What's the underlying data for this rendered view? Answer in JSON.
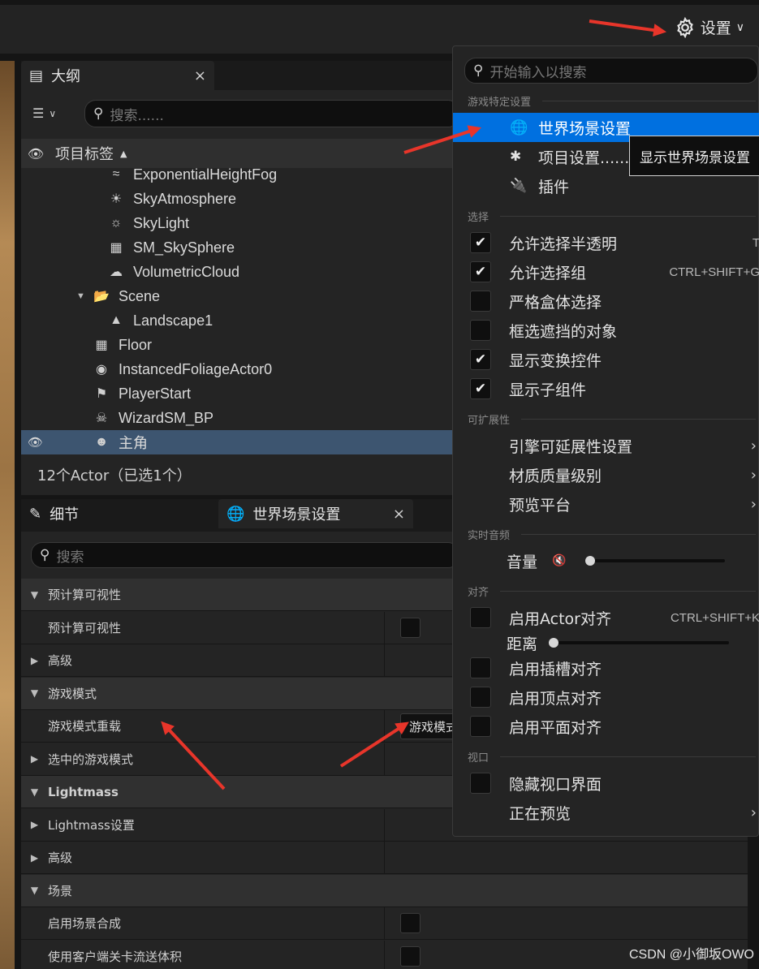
{
  "topbar": {
    "settings_label": "设置"
  },
  "outliner": {
    "tab_label": "大纲",
    "close": "×",
    "search_placeholder": "搜索......",
    "column_header": "项目标签",
    "items": [
      {
        "label": "ExponentialHeightFog",
        "icon": "fog-icon"
      },
      {
        "label": "SkyAtmosphere",
        "icon": "sky-atmosphere-icon"
      },
      {
        "label": "SkyLight",
        "icon": "skylight-icon"
      },
      {
        "label": "SM_SkySphere",
        "icon": "mesh-icon"
      },
      {
        "label": "VolumetricCloud",
        "icon": "cloud-icon"
      },
      {
        "label": "Scene",
        "icon": "folder-icon"
      },
      {
        "label": "Landscape1",
        "icon": "landscape-icon"
      },
      {
        "label": "Floor",
        "icon": "mesh-icon"
      },
      {
        "label": "InstancedFoliageActor0",
        "icon": "foliage-icon"
      },
      {
        "label": "PlayerStart",
        "icon": "player-start-icon"
      },
      {
        "label": "WizardSM_BP",
        "icon": "skeleton-icon"
      },
      {
        "label": "主角",
        "icon": "character-icon"
      }
    ],
    "footer": "12个Actor（已选1个）"
  },
  "details": {
    "tab_details": "细节",
    "tab_world": "世界场景设置",
    "close": "×",
    "search_placeholder": "搜索",
    "rows": [
      {
        "label": "预计算可视性",
        "type": "category"
      },
      {
        "label": "预计算可视性",
        "type": "property"
      },
      {
        "label": "高级",
        "type": "collapsed"
      },
      {
        "label": "游戏模式",
        "type": "category"
      },
      {
        "label": "游戏模式重载",
        "type": "property"
      },
      {
        "label": "选中的游戏模式",
        "type": "collapsed"
      },
      {
        "label": "Lightmass",
        "type": "category"
      },
      {
        "label": "Lightmass设置",
        "type": "collapsed"
      },
      {
        "label": "高级",
        "type": "collapsed"
      },
      {
        "label": "场景",
        "type": "category"
      },
      {
        "label": "启用场景合成",
        "type": "property"
      },
      {
        "label": "使用客户端关卡流送体积",
        "type": "property"
      }
    ],
    "gamemode_value": "游戏模式"
  },
  "menu": {
    "search_placeholder": "开始输入以搜索",
    "sections": {
      "game": "游戏特定设置",
      "select": "选择",
      "ext": "可扩展性",
      "audio": "实时音频",
      "snap": "对齐",
      "viewport": "视口"
    },
    "world_settings": "世界场景设置",
    "project_settings": "项目设置......",
    "plugins": "插件",
    "translucent": "允许选择半透明",
    "translucent_key": "T",
    "groups": "允许选择组",
    "groups_key": "CTRL+SHIFT+G",
    "strict_box": "严格盒体选择",
    "occluded": "框选遮挡的对象",
    "transform_widget": "显示变换控件",
    "subcomponents": "显示子组件",
    "engine_scal": "引擎可延展性设置",
    "material_quality": "材质质量级别",
    "preview_platform": "预览平台",
    "volume": "音量",
    "actor_snap": "启用Actor对齐",
    "actor_snap_key": "CTRL+SHIFT+K",
    "distance": "距离",
    "socket_snap": "启用插槽对齐",
    "vertex_snap": "启用顶点对齐",
    "plane_snap": "启用平面对齐",
    "hide_ui": "隐藏视口界面",
    "previewing": "正在预览"
  },
  "tooltip": "显示世界场景设置",
  "watermark": "CSDN @小御坂OWO",
  "colors": {
    "accent": "#0070e0",
    "selection": "#3d5570",
    "arrow": "#e8352a"
  }
}
